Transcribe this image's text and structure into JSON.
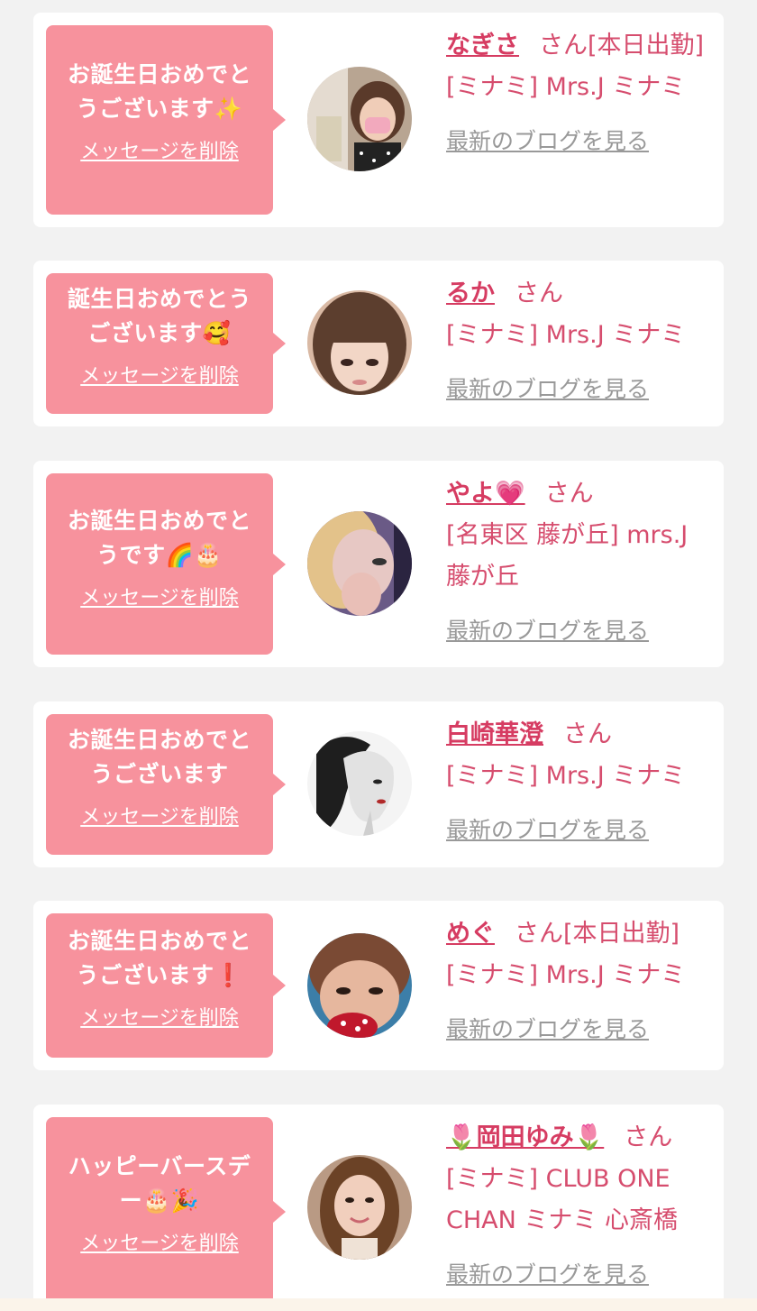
{
  "colors": {
    "bubble": "#f7929d",
    "name": "#d63c62",
    "text": "#d64d6e",
    "blog": "#999999"
  },
  "delete_label": "メッセージを削除",
  "blog_label": "最新のブログを見る",
  "cards": [
    {
      "message": [
        "お誕生日おめでと",
        "うございます✨"
      ],
      "name": "なぎさ",
      "suffix": "さん",
      "status": "[本日出勤]",
      "shop": "[ミナミ] Mrs.J ミナミ",
      "avatar_icon": "woman-with-pink-mask-photo"
    },
    {
      "message": [
        "誕生日おめでとう",
        "ございます🥰"
      ],
      "name": "るか",
      "suffix": "さん",
      "status": "",
      "shop": "[ミナミ] Mrs.J ミナミ",
      "avatar_icon": "woman-with-bangs-photo"
    },
    {
      "message": [
        "お誕生日おめでと",
        "うです🌈🎂"
      ],
      "name": "やよ💗",
      "suffix": "さん",
      "status": "",
      "shop": "[名東区 藤が丘] mrs.J 藤が丘",
      "avatar_icon": "woman-covering-face-photo"
    },
    {
      "message": [
        "お誕生日おめでと",
        "うございます"
      ],
      "name": "白崎華澄",
      "suffix": "さん",
      "status": "",
      "shop": "[ミナミ] Mrs.J ミナミ",
      "avatar_icon": "monochrome-illustration-woman"
    },
    {
      "message": [
        "お誕生日おめでと",
        "うございます❗"
      ],
      "name": "めぐ",
      "suffix": "さん",
      "status": "[本日出勤]",
      "shop": "[ミナミ] Mrs.J ミナミ",
      "avatar_icon": "woman-eyes-with-red-object-photo"
    },
    {
      "message": [
        "ハッピーバースデ",
        "ー🎂🎉"
      ],
      "name": "🌷岡田ゆみ🌷",
      "suffix": "さん",
      "status": "",
      "shop": "[ミナミ] CLUB ONE CHAN ミナミ 心斎橋",
      "avatar_icon": "smiling-woman-long-hair-photo"
    }
  ]
}
